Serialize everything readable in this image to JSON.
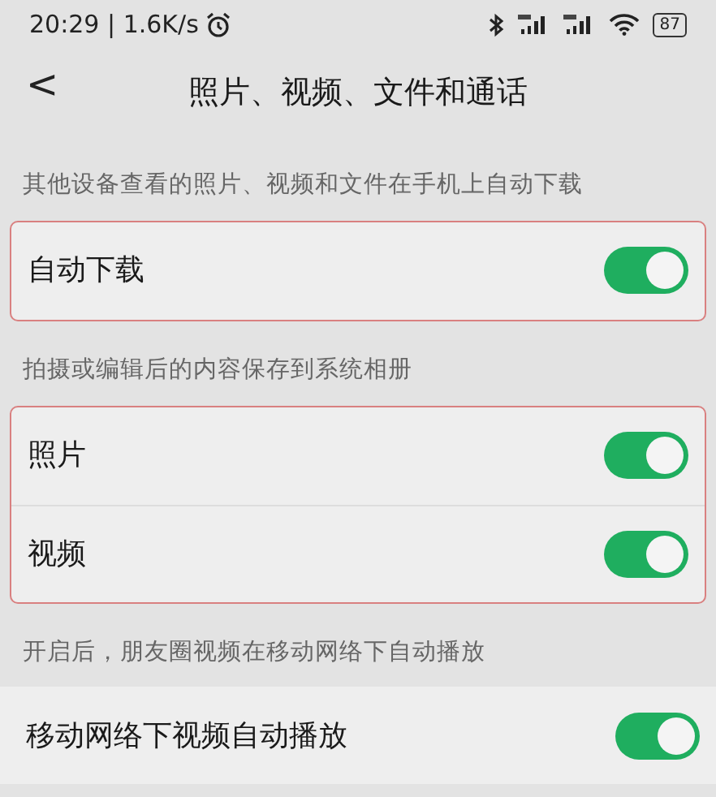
{
  "status_bar": {
    "time": "20:29 | 1.6K/s",
    "battery": "87"
  },
  "header": {
    "back": "<",
    "title": "照片、视频、文件和通话"
  },
  "sections": [
    {
      "caption": "其他设备查看的照片、视频和文件在手机上自动下载",
      "highlighted": true,
      "rows": [
        {
          "label": "自动下载",
          "on": true
        }
      ]
    },
    {
      "caption": "拍摄或编辑后的内容保存到系统相册",
      "highlighted": true,
      "rows": [
        {
          "label": "照片",
          "on": true
        },
        {
          "label": "视频",
          "on": true
        }
      ]
    },
    {
      "caption": "开启后，朋友圈视频在移动网络下自动播放",
      "highlighted": false,
      "rows": [
        {
          "label": "移动网络下视频自动播放",
          "on": true
        }
      ]
    }
  ]
}
